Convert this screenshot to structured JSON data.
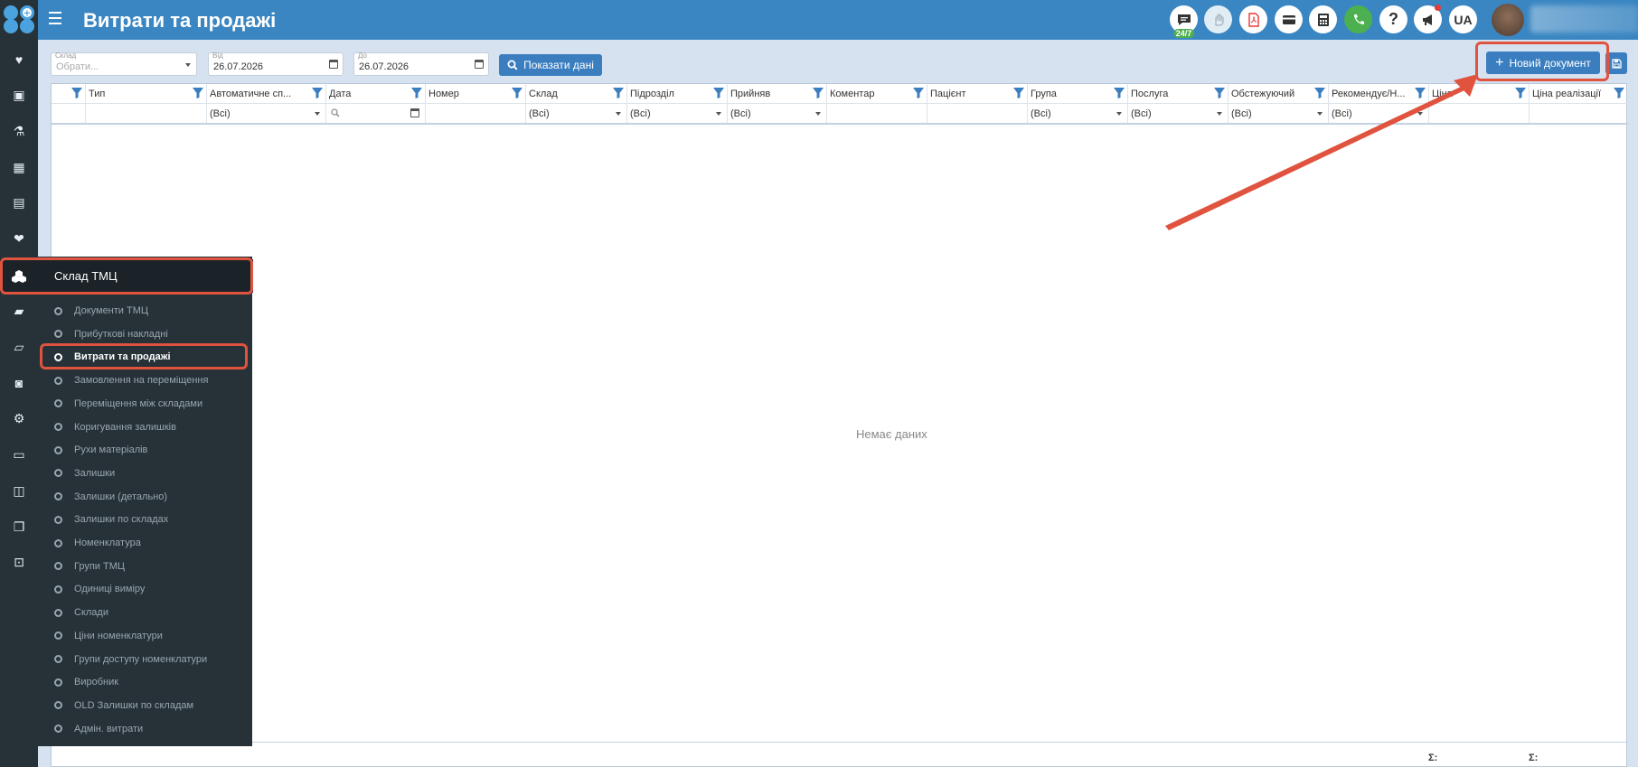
{
  "header": {
    "title": "Витрати та продажі",
    "chat_badge": "24/7",
    "lang_label": "UA"
  },
  "toolbar": {
    "warehouse": {
      "label": "Склад",
      "placeholder": "Обрати..."
    },
    "date_from": {
      "label": "Від",
      "value": "26.07.2026"
    },
    "date_to": {
      "label": "До",
      "value": "26.07.2026"
    },
    "show_button_label": "Показати дані",
    "new_document_label": "Новий документ"
  },
  "grid": {
    "columns": [
      {
        "label": "Тип",
        "filter": ""
      },
      {
        "label": "Автоматичне сп...",
        "filter": "(Всі)"
      },
      {
        "label": "Дата",
        "filter": ""
      },
      {
        "label": "Номер",
        "filter": ""
      },
      {
        "label": "Склад",
        "filter": "(Всі)"
      },
      {
        "label": "Підрозділ",
        "filter": "(Всі)"
      },
      {
        "label": "Прийняв",
        "filter": "(Всі)"
      },
      {
        "label": "Коментар",
        "filter": ""
      },
      {
        "label": "Пацієнт",
        "filter": ""
      },
      {
        "label": "Група",
        "filter": "(Всі)"
      },
      {
        "label": "Послуга",
        "filter": "(Всі)"
      },
      {
        "label": "Обстежуючий",
        "filter": "(Всі)"
      },
      {
        "label": "Рекомендує/Н...",
        "filter": "(Всі)"
      },
      {
        "label": "Ціна",
        "filter": ""
      },
      {
        "label": "Ціна реалізації",
        "filter": ""
      }
    ],
    "empty_text": "Немає даних",
    "sum_label": "Σ:"
  },
  "menu": {
    "title": "Склад ТМЦ",
    "items": [
      "Документи ТМЦ",
      "Прибуткові накладні",
      "Витрати та продажі",
      "Замовлення на переміщення",
      "Переміщення між складами",
      "Коригування залишків",
      "Рухи матеріалів",
      "Залишки",
      "Залишки (детально)",
      "Залишки по складах",
      "Номенклатура",
      "Групи ТМЦ",
      "Одиниці виміру",
      "Склади",
      "Ціни номенклатури",
      "Групи доступу номенклатури",
      "Виробник",
      "OLD Залишки по складам",
      "Адмін. витрати"
    ],
    "active_index": 2
  },
  "colors": {
    "header_bg": "#3a86c2",
    "sidebar_bg": "#263238",
    "primary_button": "#3a7ebf",
    "highlight": "#e0533f"
  },
  "rail_icons": [
    "heart-icon",
    "contact-card-icon",
    "flask-icon",
    "calendar-icon",
    "document-icon",
    "heartbeat-icon",
    "boxes-icon",
    "book-icon",
    "folder-open-icon",
    "money-icon",
    "cogs-icon",
    "window-icon",
    "sticky-note-icon",
    "copy-icon",
    "user-lock-icon"
  ]
}
